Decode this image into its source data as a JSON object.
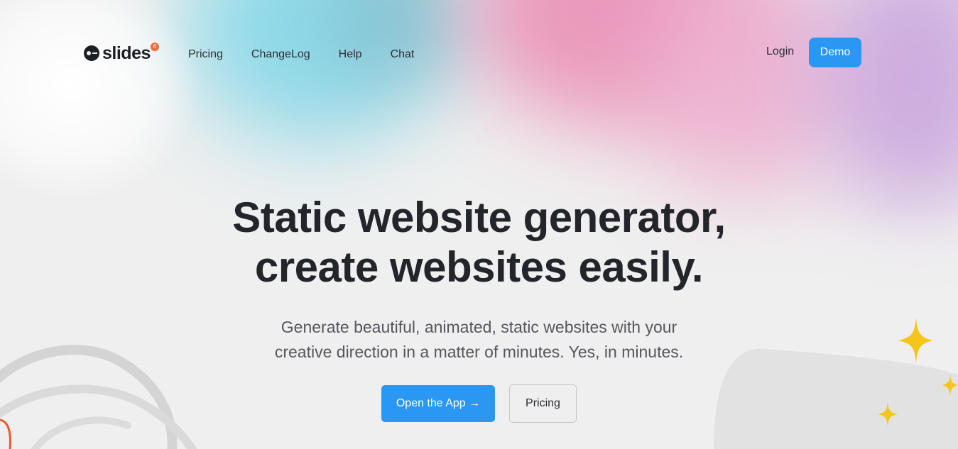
{
  "brand": {
    "name": "slides",
    "badge": "6",
    "accent_color": "#2a97f3",
    "badge_color": "#f06a3c"
  },
  "nav": {
    "items": [
      {
        "label": "Pricing"
      },
      {
        "label": "ChangeLog"
      },
      {
        "label": "Help"
      },
      {
        "label": "Chat"
      }
    ],
    "login_label": "Login",
    "demo_label": "Demo"
  },
  "hero": {
    "title_line1": "Static website generator,",
    "title_line2": "create websites easily.",
    "subtitle_line1": "Generate beautiful, animated, static websites with your",
    "subtitle_line2": "creative direction in a matter of minutes. Yes, in minutes.",
    "primary_label": "Open the App →",
    "secondary_label": "Pricing"
  },
  "decorations": {
    "sparkle_color": "#f5c518",
    "icons": [
      "sparkle-icon",
      "orange-swirl-icon",
      "grey-scribble-icon",
      "grey-blob-shape"
    ]
  }
}
